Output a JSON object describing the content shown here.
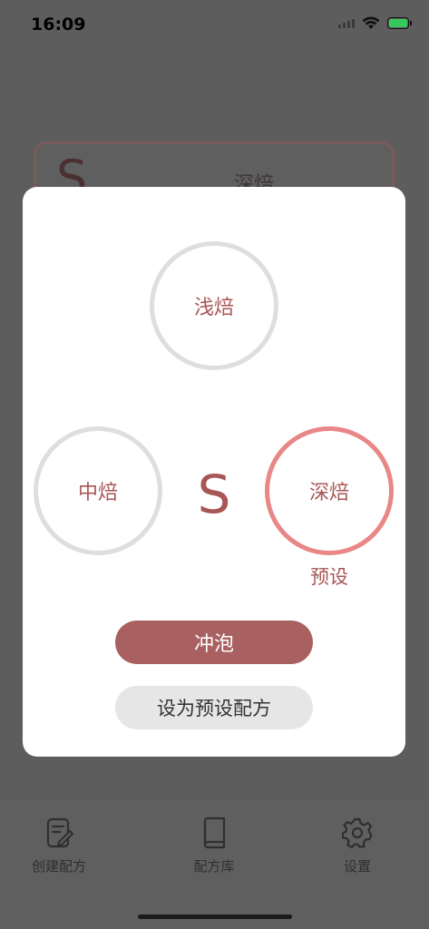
{
  "status_bar": {
    "time": "16:09"
  },
  "background_card": {
    "letter": "S",
    "title": "深焙"
  },
  "modal": {
    "roast_options": {
      "light": "浅焙",
      "medium": "中焙",
      "dark": "深焙"
    },
    "selected": "dark",
    "center_letter": "S",
    "preset_label": "预设",
    "brew_button": "冲泡",
    "set_preset_button": "设为预设配方"
  },
  "tab_bar": {
    "items": [
      {
        "label": "创建配方",
        "icon": "edit-document-icon"
      },
      {
        "label": "配方库",
        "icon": "book-icon"
      },
      {
        "label": "设置",
        "icon": "gear-icon"
      }
    ]
  },
  "colors": {
    "accent": "#a86060",
    "selected_ring": "#e98686",
    "ring": "#dedede",
    "overlay": "#5d5d5d"
  }
}
